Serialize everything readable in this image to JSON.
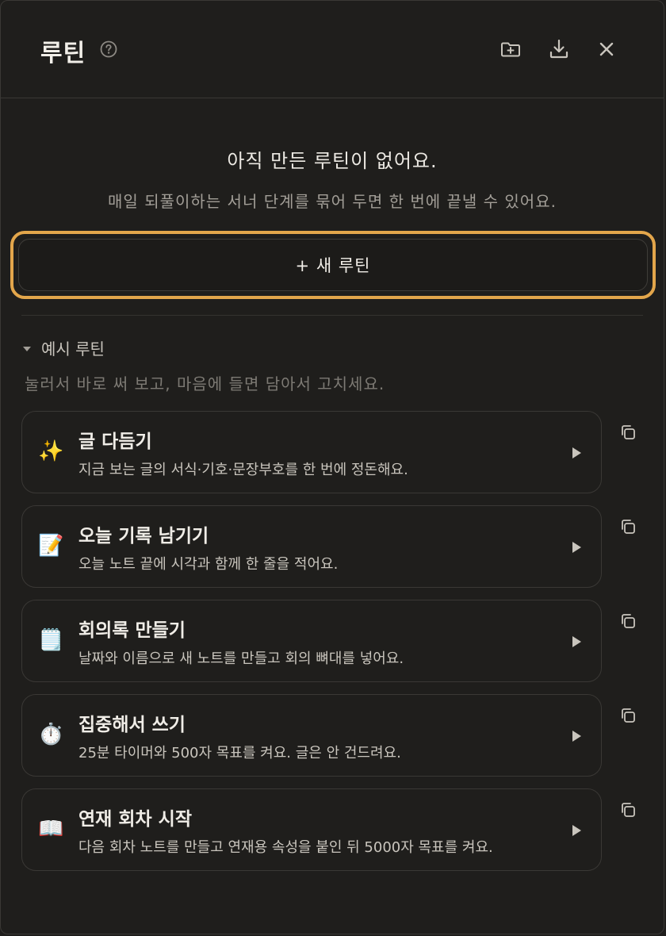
{
  "header": {
    "title": "루틴",
    "icons": [
      "help-icon",
      "new-folder-icon",
      "download-icon",
      "close-icon"
    ]
  },
  "empty_state": {
    "title": "아직 만든 루틴이 없어요.",
    "description": "매일 되풀이하는 서너 단계를 묶어 두면 한 번에 끝낼 수 있어요.",
    "new_button_label": "+ 새 루틴"
  },
  "examples": {
    "toggle_label": "예시 루틴",
    "hint": "눌러서 바로 써 보고, 마음에 들면 담아서 고치세요.",
    "items": [
      {
        "emoji": "✨",
        "name": "글 다듬기",
        "desc": "지금 보는 글의 서식·기호·문장부호를 한 번에 정돈해요."
      },
      {
        "emoji": "📝",
        "name": "오늘 기록 남기기",
        "desc": "오늘 노트 끝에 시각과 함께 한 줄을 적어요."
      },
      {
        "emoji": "🗒️",
        "name": "회의록 만들기",
        "desc": "날짜와 이름으로 새 노트를 만들고 회의 뼈대를 넣어요."
      },
      {
        "emoji": "⏱️",
        "name": "집중해서 쓰기",
        "desc": "25분 타이머와 500자 목표를 켜요. 글은 안 건드려요."
      },
      {
        "emoji": "📖",
        "name": "연재 회차 시작",
        "desc": "다음 회차 노트를 만들고 연재용 속성을 붙인 뒤 5000자 목표를 켜요."
      }
    ]
  },
  "colors": {
    "background": "#1f1e1c",
    "accent_focus": "#e3a64b",
    "border": "#3a3835"
  }
}
